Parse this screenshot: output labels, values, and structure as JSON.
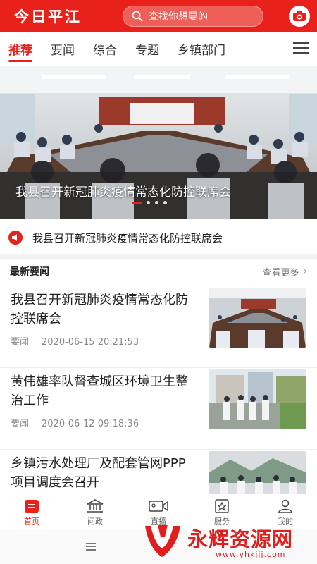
{
  "header": {
    "logo": "今日平江",
    "search_placeholder": "查找你想要的"
  },
  "tabs": [
    {
      "label": "推荐",
      "active": true
    },
    {
      "label": "要闻"
    },
    {
      "label": "综合"
    },
    {
      "label": "专题"
    },
    {
      "label": "乡镇部门"
    }
  ],
  "banner": {
    "title": "我县召开新冠肺炎疫情常态化防控联席会",
    "slide_count": 4,
    "active_slide": 1
  },
  "notice": {
    "text": "我县召开新冠肺炎疫情常态化防控联席会"
  },
  "section": {
    "title": "最新要闻",
    "more_label": "查看更多"
  },
  "news": [
    {
      "title": "我县召开新冠肺炎疫情常态化防控联席会",
      "category": "要闻",
      "time": "2020-06-15 20:21:53"
    },
    {
      "title": "黄伟雄率队督查城区环境卫生整治工作",
      "category": "要闻",
      "time": "2020-06-12 09:18:36"
    },
    {
      "title": "乡镇污水处理厂及配套管网PPP项目调度会召开",
      "category": "",
      "time": ""
    }
  ],
  "bottom_nav": [
    {
      "label": "首页",
      "icon": "home-icon",
      "active": true
    },
    {
      "label": "问政",
      "icon": "government-icon"
    },
    {
      "label": "直播",
      "icon": "video-camera-icon"
    },
    {
      "label": "服务",
      "icon": "service-star-icon"
    },
    {
      "label": "我的",
      "icon": "user-icon"
    }
  ],
  "watermark": {
    "text": "永辉资源网",
    "url": "www.yhkjjj.com"
  },
  "colors": {
    "brand": "#e8221b",
    "text": "#222222",
    "muted": "#888888"
  }
}
